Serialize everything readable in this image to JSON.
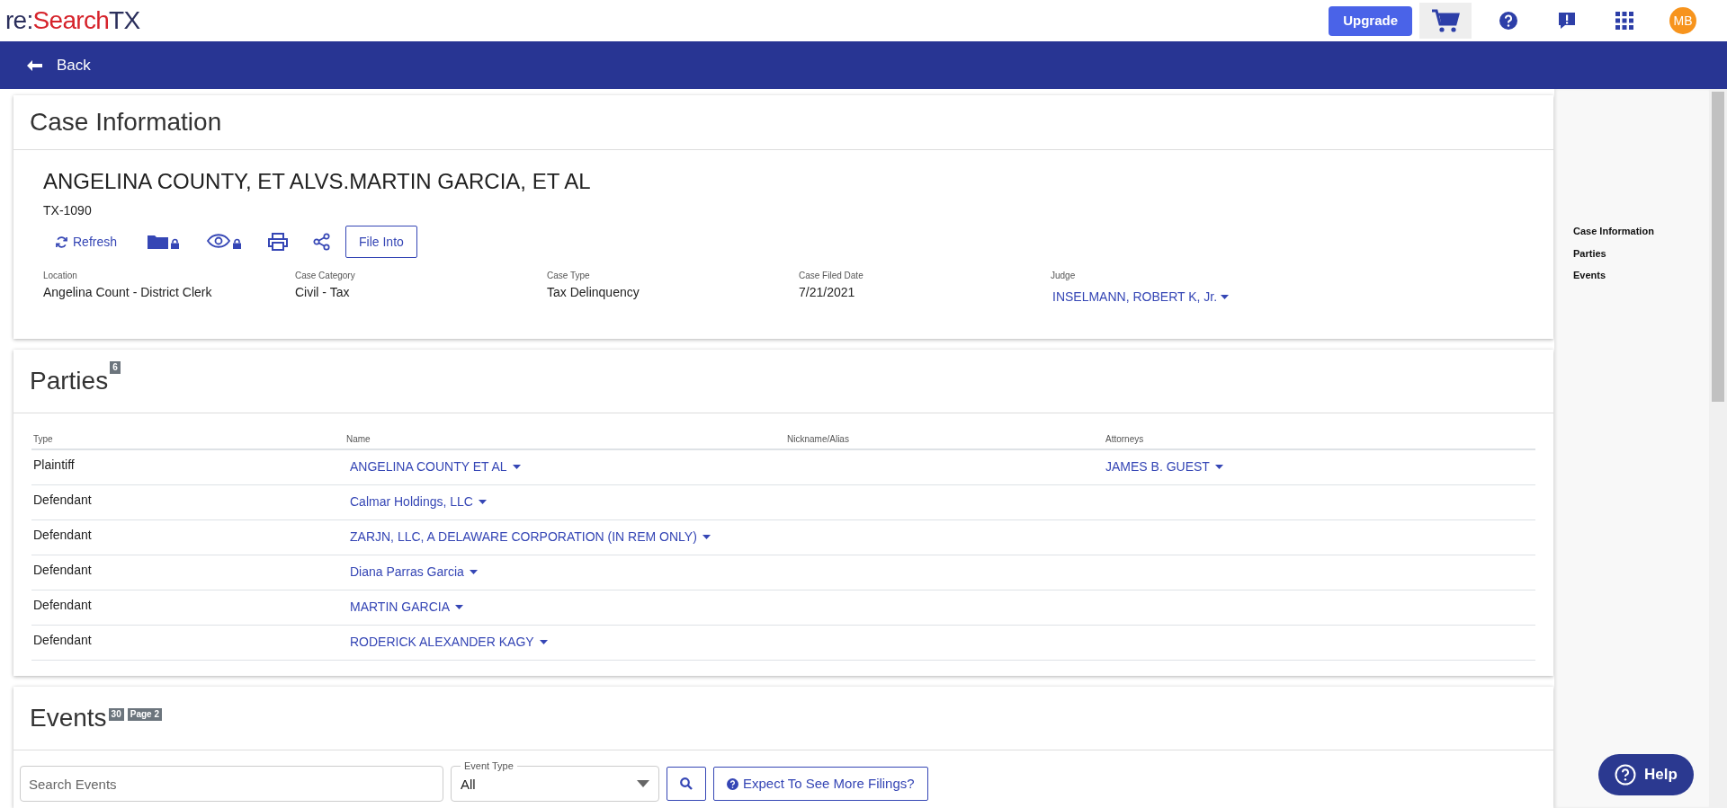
{
  "header": {
    "logo": [
      {
        "text": "re:",
        "color": "#2b2f5c"
      },
      {
        "text": "Search",
        "color": "#d6232b"
      },
      {
        "text": "TX",
        "color": "#2b2f5c"
      }
    ],
    "upgrade_button": "Upgrade",
    "avatar": "MB"
  },
  "nav_bar": {
    "back": "Back"
  },
  "case_information": {
    "title": "Case Information",
    "case_name": "ANGELINA COUNTY, ET ALVS.MARTIN GARCIA, ET AL",
    "case_number": "TX-1090",
    "actions": [
      {
        "kind": "refresh",
        "label": "Refresh"
      },
      {
        "kind": "folder_locked"
      },
      {
        "kind": "view_locked"
      },
      {
        "kind": "print"
      },
      {
        "kind": "share"
      },
      {
        "kind": "file_into",
        "label": "File Into"
      }
    ],
    "fields": [
      {
        "label": "Location",
        "value": "Angelina Count - District Clerk",
        "kind": "text"
      },
      {
        "label": "Case Category",
        "value": "Civil - Tax",
        "kind": "text"
      },
      {
        "label": "Case Type",
        "value": "Tax Delinquency",
        "kind": "text"
      },
      {
        "label": "Case Filed Date",
        "value": "7/21/2021",
        "kind": "text"
      },
      {
        "label": "Judge",
        "value": "INSELMANN, ROBERT K, Jr.",
        "kind": "link"
      }
    ]
  },
  "parties": {
    "title": "Parties",
    "count": "6",
    "columns": [
      "Type",
      "Name",
      "Nickname/Alias",
      "Attorneys"
    ],
    "rows": [
      {
        "type": "Plaintiff",
        "name": "ANGELINA COUNTY ET AL",
        "attorney": "JAMES B. GUEST"
      },
      {
        "type": "Defendant",
        "name": "Calmar Holdings, LLC"
      },
      {
        "type": "Defendant",
        "name": "ZARJN, LLC, A DELAWARE CORPORATION (IN REM ONLY)"
      },
      {
        "type": "Defendant",
        "name": "Diana Parras Garcia"
      },
      {
        "type": "Defendant",
        "name": "MARTIN GARCIA"
      },
      {
        "type": "Defendant",
        "name": "RODERICK ALEXANDER KAGY"
      }
    ]
  },
  "events": {
    "title": "Events",
    "count": "30",
    "page": "Page 2",
    "search": {
      "placeholder": "Search Events"
    },
    "event_type": {
      "label": "Event Type",
      "value": "All"
    },
    "expect_button": "Expect To See More Filings?"
  },
  "side_nav": {
    "items": [
      "Case Information",
      "Parties",
      "Events"
    ]
  },
  "help_button": "Help"
}
